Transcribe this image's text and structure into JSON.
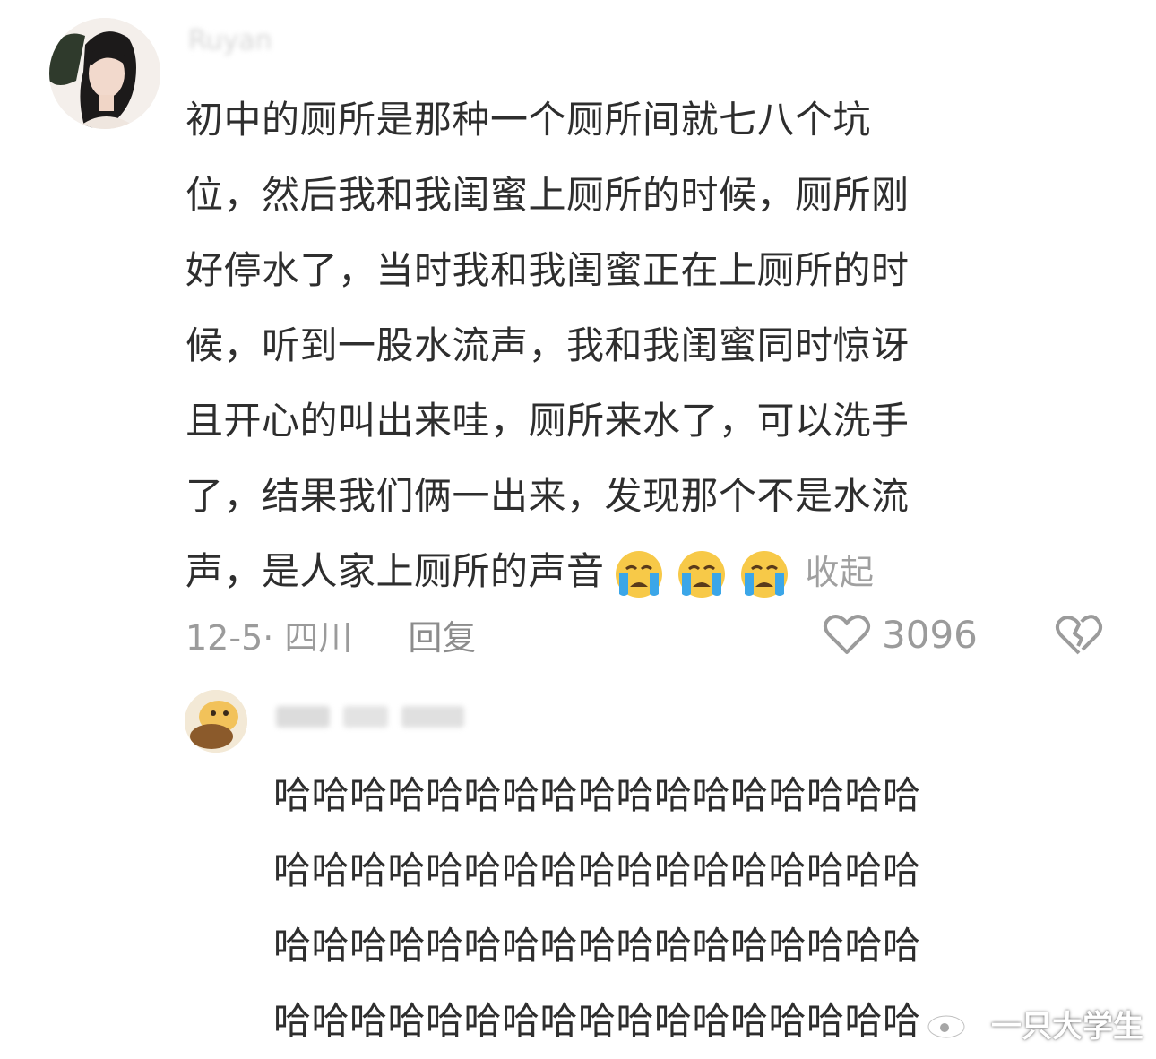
{
  "comment": {
    "username": "Ruyan",
    "lines": [
      "初中的厕所是那种一个厕所间就七八个坑",
      "位，然后我和我闺蜜上厕所的时候，厕所刚",
      "好停水了，当时我和我闺蜜正在上厕所的时",
      "候，听到一股水流声，我和我闺蜜同时惊讶",
      "且开心的叫出来哇，厕所来水了，可以洗手",
      "了，结果我们俩一出来，发现那个不是水流",
      "声，是人家上厕所的声音"
    ],
    "emoji": [
      "crying-face",
      "crying-face",
      "crying-face"
    ],
    "collapse_label": "收起",
    "date_location": "12-5· 四川",
    "reply_label": "回复",
    "like_count": "3096"
  },
  "reply": {
    "lines": [
      "哈哈哈哈哈哈哈哈哈哈哈哈哈哈哈哈哈",
      "哈哈哈哈哈哈哈哈哈哈哈哈哈哈哈哈哈",
      "哈哈哈哈哈哈哈哈哈哈哈哈哈哈哈哈哈",
      "哈哈哈哈哈哈哈哈哈哈哈哈哈哈哈哈哈"
    ]
  },
  "watermark": {
    "text": "一只大学生"
  },
  "colors": {
    "text": "#2e2e2e",
    "muted": "#9b9b9b",
    "emoji_face": "#f7c948",
    "emoji_tear": "#3ba6e8"
  }
}
